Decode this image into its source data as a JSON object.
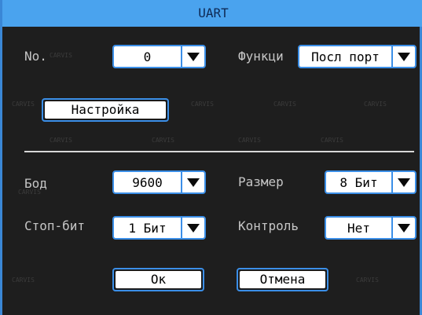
{
  "title": "UART",
  "fields": {
    "no_label": "No.",
    "no_value": "0",
    "function_label": "Функци",
    "function_value": "Посл порт",
    "baud_label": "Бод",
    "baud_value": "9600",
    "size_label": "Размер",
    "size_value": "8 Бит",
    "stop_label": "Стоп-бит",
    "stop_value": "1 Бит",
    "control_label": "Контроль",
    "control_value": "Нет"
  },
  "buttons": {
    "settings": "Настройка",
    "ok": "Ок",
    "cancel": "Отмена"
  },
  "watermark": "CARVIS",
  "colors": {
    "accent": "#3b8fe8",
    "title_bar": "#4aa3ee",
    "background": "#1e1e1e"
  }
}
